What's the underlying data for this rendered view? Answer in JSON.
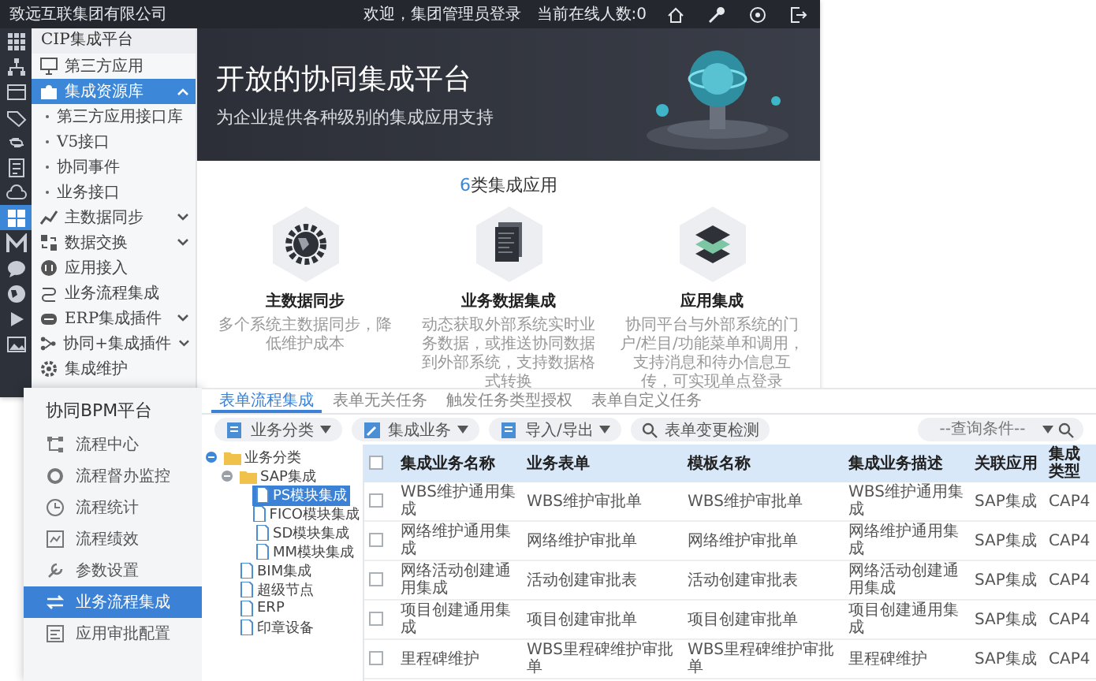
{
  "back_window": {
    "company": "致远互联集团有限公司",
    "welcome": "欢迎，集团管理员登录",
    "online": "当前在线人数:0",
    "rail": [
      {
        "selected": false
      },
      {
        "selected": false
      },
      {
        "selected": false
      },
      {
        "selected": false
      },
      {
        "selected": false
      },
      {
        "selected": false
      },
      {
        "selected": false
      },
      {
        "selected": true
      },
      {
        "selected": false
      },
      {
        "selected": false
      },
      {
        "selected": false
      },
      {
        "selected": false
      },
      {
        "selected": false
      }
    ],
    "sidebar": {
      "title": "CIP集成平台",
      "items": [
        {
          "label": "第三方应用",
          "kind": "link",
          "selected": false
        },
        {
          "label": "集成资源库",
          "kind": "group",
          "selected": true,
          "expanded": true,
          "children": [
            {
              "label": "第三方应用接口库",
              "selected": false
            },
            {
              "label": "V5接口",
              "selected": false
            },
            {
              "label": "协同事件",
              "selected": false
            },
            {
              "label": "业务接口",
              "selected": false
            }
          ]
        },
        {
          "label": "主数据同步",
          "kind": "group",
          "selected": false,
          "expanded": false
        },
        {
          "label": "数据交换",
          "kind": "group",
          "selected": false,
          "expanded": false
        },
        {
          "label": "应用接入",
          "kind": "link",
          "selected": false
        },
        {
          "label": "业务流程集成",
          "kind": "link",
          "selected": false
        },
        {
          "label": "ERP集成插件",
          "kind": "group",
          "selected": false,
          "expanded": false
        },
        {
          "label": "协同+集成插件",
          "kind": "group",
          "selected": false,
          "expanded": false
        },
        {
          "label": "集成维护",
          "kind": "link",
          "selected": false
        }
      ]
    },
    "hero": {
      "title": "开放的协同集成平台",
      "subtitle": "为企业提供各种级别的集成应用支持"
    },
    "section": {
      "count": "6",
      "title": "类集成应用"
    },
    "cards": [
      {
        "title": "主数据同步",
        "description": "多个系统主数据同步，降低维护成本"
      },
      {
        "title": "业务数据集成",
        "description": "动态获取外部系统实时业务数据，或推送协同数据到外部系统，支持数据格式转换"
      },
      {
        "title": "应用集成",
        "description": "协同平台与外部系统的门户/栏目/功能菜单和调用，支持消息和待办信息互传，可实现单点登录"
      }
    ]
  },
  "front_window": {
    "title": "协同BPM平台",
    "nav": [
      {
        "label": "流程中心",
        "selected": false
      },
      {
        "label": "流程督办监控",
        "selected": false
      },
      {
        "label": "流程统计",
        "selected": false
      },
      {
        "label": "流程绩效",
        "selected": false
      },
      {
        "label": "参数设置",
        "selected": false
      },
      {
        "label": "业务流程集成",
        "selected": true
      },
      {
        "label": "应用审批配置",
        "selected": false
      }
    ],
    "tabs": [
      {
        "label": "表单流程集成",
        "selected": true
      },
      {
        "label": "表单无关任务",
        "selected": false
      },
      {
        "label": "触发任务类型授权",
        "selected": false
      },
      {
        "label": "表单自定义任务",
        "selected": false
      }
    ],
    "toolbar": [
      {
        "label": "业务分类",
        "kind": "dropdown"
      },
      {
        "label": "集成业务",
        "kind": "dropdown"
      },
      {
        "label": "导入/导出",
        "kind": "dropdown"
      },
      {
        "label": "表单变更检测",
        "kind": "search"
      }
    ],
    "query": {
      "placeholder": "--查询条件--"
    },
    "tree": [
      {
        "label": "业务分类",
        "selected": false,
        "expanded": true,
        "children": [
          {
            "label": "SAP集成",
            "selected": false,
            "expanded": true,
            "children": [
              {
                "label": "PS模块集成",
                "selected": true
              },
              {
                "label": "FICO模块集成",
                "selected": false
              },
              {
                "label": "SD模块集成",
                "selected": false
              },
              {
                "label": "MM模块集成",
                "selected": false
              }
            ]
          },
          {
            "label": "BIM集成",
            "selected": false
          },
          {
            "label": "超级节点",
            "selected": false
          },
          {
            "label": "ERP",
            "selected": false
          },
          {
            "label": "印章设备",
            "selected": false
          }
        ]
      }
    ],
    "table": {
      "all_checked": false,
      "columns": [
        "集成业务名称",
        "业务表单",
        "模板名称",
        "集成业务描述",
        "关联应用",
        "集成类型"
      ],
      "rows": [
        {
          "checked": false,
          "cells": [
            "WBS维护通用集成",
            "WBS维护审批单",
            "WBS维护审批单",
            "WBS维护通用集成",
            "SAP集成",
            "CAP4"
          ]
        },
        {
          "checked": false,
          "cells": [
            "网络维护通用集成",
            "网络维护审批单",
            "网络维护审批单",
            "网络维护通用集成",
            "SAP集成",
            "CAP4"
          ]
        },
        {
          "checked": false,
          "cells": [
            "网络活动创建通用集成",
            "活动创建审批表",
            "活动创建审批表",
            "网络活动创建通用集成",
            "SAP集成",
            "CAP4"
          ]
        },
        {
          "checked": false,
          "cells": [
            "项目创建通用集成",
            "项目创建审批单",
            "项目创建审批单",
            "项目创建通用集成",
            "SAP集成",
            "CAP4"
          ]
        },
        {
          "checked": false,
          "cells": [
            "里程碑维护",
            "WBS里程碑维护审批单",
            "WBS里程碑维护审批单",
            "里程碑维护",
            "SAP集成",
            "CAP4"
          ]
        }
      ]
    }
  }
}
